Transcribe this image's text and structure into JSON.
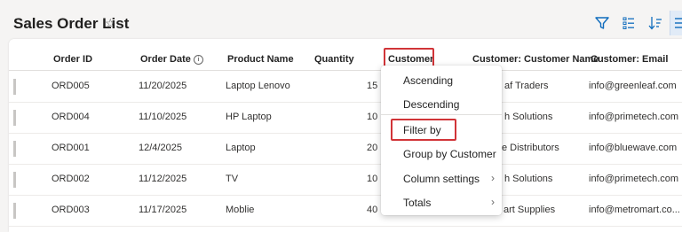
{
  "page": {
    "title": "Sales Order List"
  },
  "columns": {
    "order_id": "Order ID",
    "order_date": "Order Date",
    "product_name": "Product Name",
    "quantity": "Quantity",
    "customer": "Customer",
    "customer_name": "Customer: Customer Name",
    "customer_email": "Customer: Email"
  },
  "rows": [
    {
      "order_id": "ORD005",
      "order_date": "11/20/2025",
      "product_name": "Laptop Lenovo",
      "quantity": "15",
      "customer_name": "af Traders",
      "email": "info@greenleaf.com"
    },
    {
      "order_id": "ORD004",
      "order_date": "11/10/2025",
      "product_name": "HP Laptop",
      "quantity": "10",
      "customer_name": "h Solutions",
      "email": "info@primetech.com"
    },
    {
      "order_id": "ORD001",
      "order_date": "12/4/2025",
      "product_name": "Laptop",
      "quantity": "20",
      "customer_name": "e Distributors",
      "email": "info@bluewave.com"
    },
    {
      "order_id": "ORD002",
      "order_date": "11/12/2025",
      "product_name": "TV",
      "quantity": "10",
      "customer_name": "h Solutions",
      "email": "info@primetech.com"
    },
    {
      "order_id": "ORD003",
      "order_date": "11/17/2025",
      "product_name": "Moblie",
      "quantity": "40",
      "customer_name": "art Supplies",
      "email": "info@metromart.co..."
    }
  ],
  "menu": {
    "ascending": "Ascending",
    "descending": "Descending",
    "filter_by": "Filter by",
    "group_by": "Group by Customer",
    "column_settings": "Column settings",
    "totals": "Totals"
  },
  "icons": {
    "favorite": "star-outline",
    "filter": "funnel",
    "edit_columns": "list-edit",
    "sort": "sort-arrows",
    "view": "list-lines"
  },
  "colors": {
    "accent": "#0f6cbd",
    "highlight_box": "#d13438"
  }
}
